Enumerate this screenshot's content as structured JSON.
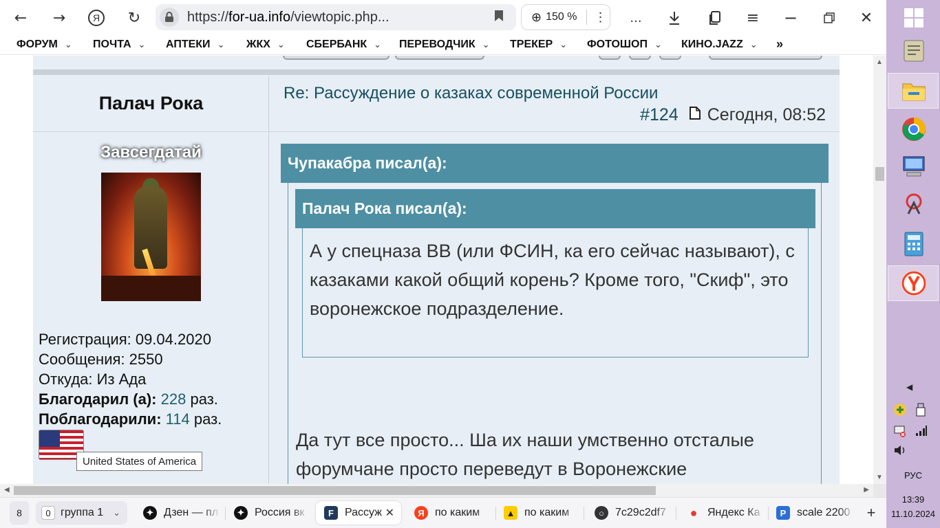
{
  "browser": {
    "url": "https://for-ua.info/viewtopic.php...",
    "url_domain": "for-ua.info",
    "zoom": "150 %",
    "more_label": "...",
    "bookmarks": [
      "ФОРУМ",
      "ПОЧТА",
      "АПТЕКИ",
      "ЖКХ",
      "СБЕРБАНК",
      "ПЕРЕВОДЧИК",
      "ТРЕКЕР",
      "ФОТОШОП",
      "КИНО.JAZZ"
    ],
    "bookmarks_more": "»"
  },
  "post": {
    "author": "Палач Рока",
    "rank": "Завсегдатай",
    "registration": "Регистрация: 09.04.2020",
    "messages": "Сообщения: 2550",
    "location": "Откуда: Из Ада",
    "thanked_label": "Благодарил (а):",
    "thanked_count": "228",
    "thanked_suffix": "раз.",
    "was_thanked_label": "Поблагодарили:",
    "was_thanked_count": "114",
    "was_thanked_suffix": "раз.",
    "country_tooltip": "United States of America",
    "title": "Re: Рассуждение о казаках современной России",
    "number": "#124",
    "date": "Сегодня, 08:52",
    "outer_quote_author": "Чупакабра писал(а):",
    "inner_quote_author": "Палач Рока писал(а):",
    "inner_quote_text": "А у спецназа ВВ (или ФСИН, ка его сейчас называют), с казаками какой общий корень? Кроме того, \"Скиф\", это воронежское подразделение.",
    "reply_text": "Да тут все просто... Ша их наши умственно отсталые форумчане просто переведут в Воронежские"
  },
  "tabs": {
    "count": "8",
    "group_count": "0",
    "group_label": "группа 1",
    "items": [
      {
        "label": "Дзен — пл",
        "icon": "zen-icon"
      },
      {
        "label": "Россия вк",
        "icon": "zen-icon"
      },
      {
        "label": "Рассуж",
        "icon": "forum-icon",
        "active": true
      },
      {
        "label": "по каким",
        "icon": "yandex-icon"
      },
      {
        "label": "по каким",
        "icon": "images-icon"
      },
      {
        "label": "7c29c2df7",
        "icon": "file-icon"
      },
      {
        "label": "Яндекс Ка",
        "icon": "maps-icon"
      },
      {
        "label": "scale 2200",
        "icon": "scale-icon"
      }
    ],
    "new_tab": "+"
  },
  "system": {
    "language": "РУС",
    "time": "13:39",
    "date": "11.10.2024"
  },
  "colors": {
    "accent": "#4e8fa3",
    "link": "#174f5f",
    "panel": "#e7eef5",
    "taskbar": "#c9b6d9"
  }
}
